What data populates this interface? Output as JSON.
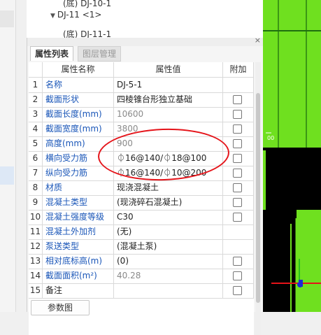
{
  "tree": {
    "items": [
      {
        "label": "(底) DJ-10-1",
        "indent": 2
      },
      {
        "label": "DJ-11 <1>",
        "indent": 1,
        "expanded": true
      },
      {
        "label": "(底) DJ-11-1",
        "indent": 2
      }
    ]
  },
  "panel": {
    "close_label": "×",
    "tabs": [
      {
        "label": "属性列表",
        "active": true
      },
      {
        "label": "图层管理",
        "active": false
      }
    ],
    "columns": {
      "name": "属性名称",
      "value": "属性值",
      "add": "附加"
    },
    "rows": [
      {
        "num": "1",
        "name": "名称",
        "value": "DJ-5-1",
        "checkbox": false
      },
      {
        "num": "2",
        "name": "截面形状",
        "value": "四棱锥台形独立基础",
        "checkbox": true
      },
      {
        "num": "3",
        "name": "截面长度(mm)",
        "value": "10600",
        "checkbox": true,
        "gray": true
      },
      {
        "num": "4",
        "name": "截面宽度(mm)",
        "value": "3800",
        "checkbox": true,
        "gray": true
      },
      {
        "num": "5",
        "name": "高度(mm)",
        "value": "900",
        "checkbox": true,
        "gray": true
      },
      {
        "num": "6",
        "name": "横向受力筋",
        "value": "⏀16@140/⏀18@100",
        "checkbox": true
      },
      {
        "num": "7",
        "name": "纵向受力筋",
        "value": "⏀16@140/⏀10@200",
        "checkbox": true
      },
      {
        "num": "8",
        "name": "材质",
        "value": "现浇混凝土",
        "checkbox": true
      },
      {
        "num": "9",
        "name": "混凝土类型",
        "value": "(现浇碎石混凝土)",
        "checkbox": true
      },
      {
        "num": "10",
        "name": "混凝土强度等级",
        "value": "C30",
        "checkbox": true
      },
      {
        "num": "11",
        "name": "混凝土外加剂",
        "value": "(无)",
        "checkbox": false
      },
      {
        "num": "12",
        "name": "泵送类型",
        "value": "(混凝土泵)",
        "checkbox": false
      },
      {
        "num": "13",
        "name": "相对底标高(m)",
        "value": "(0)",
        "checkbox": true
      },
      {
        "num": "14",
        "name": "截面面积(m²)",
        "value": "40.28",
        "checkbox": true,
        "gray": true
      },
      {
        "num": "15",
        "name": "备注",
        "value": "",
        "checkbox": true,
        "black_name": true
      }
    ],
    "bottom_button": "参数图"
  },
  "colors": {
    "link_blue": "#1a56b8",
    "cad_green": "#6fe01f",
    "annotation_red": "#e5141a"
  }
}
